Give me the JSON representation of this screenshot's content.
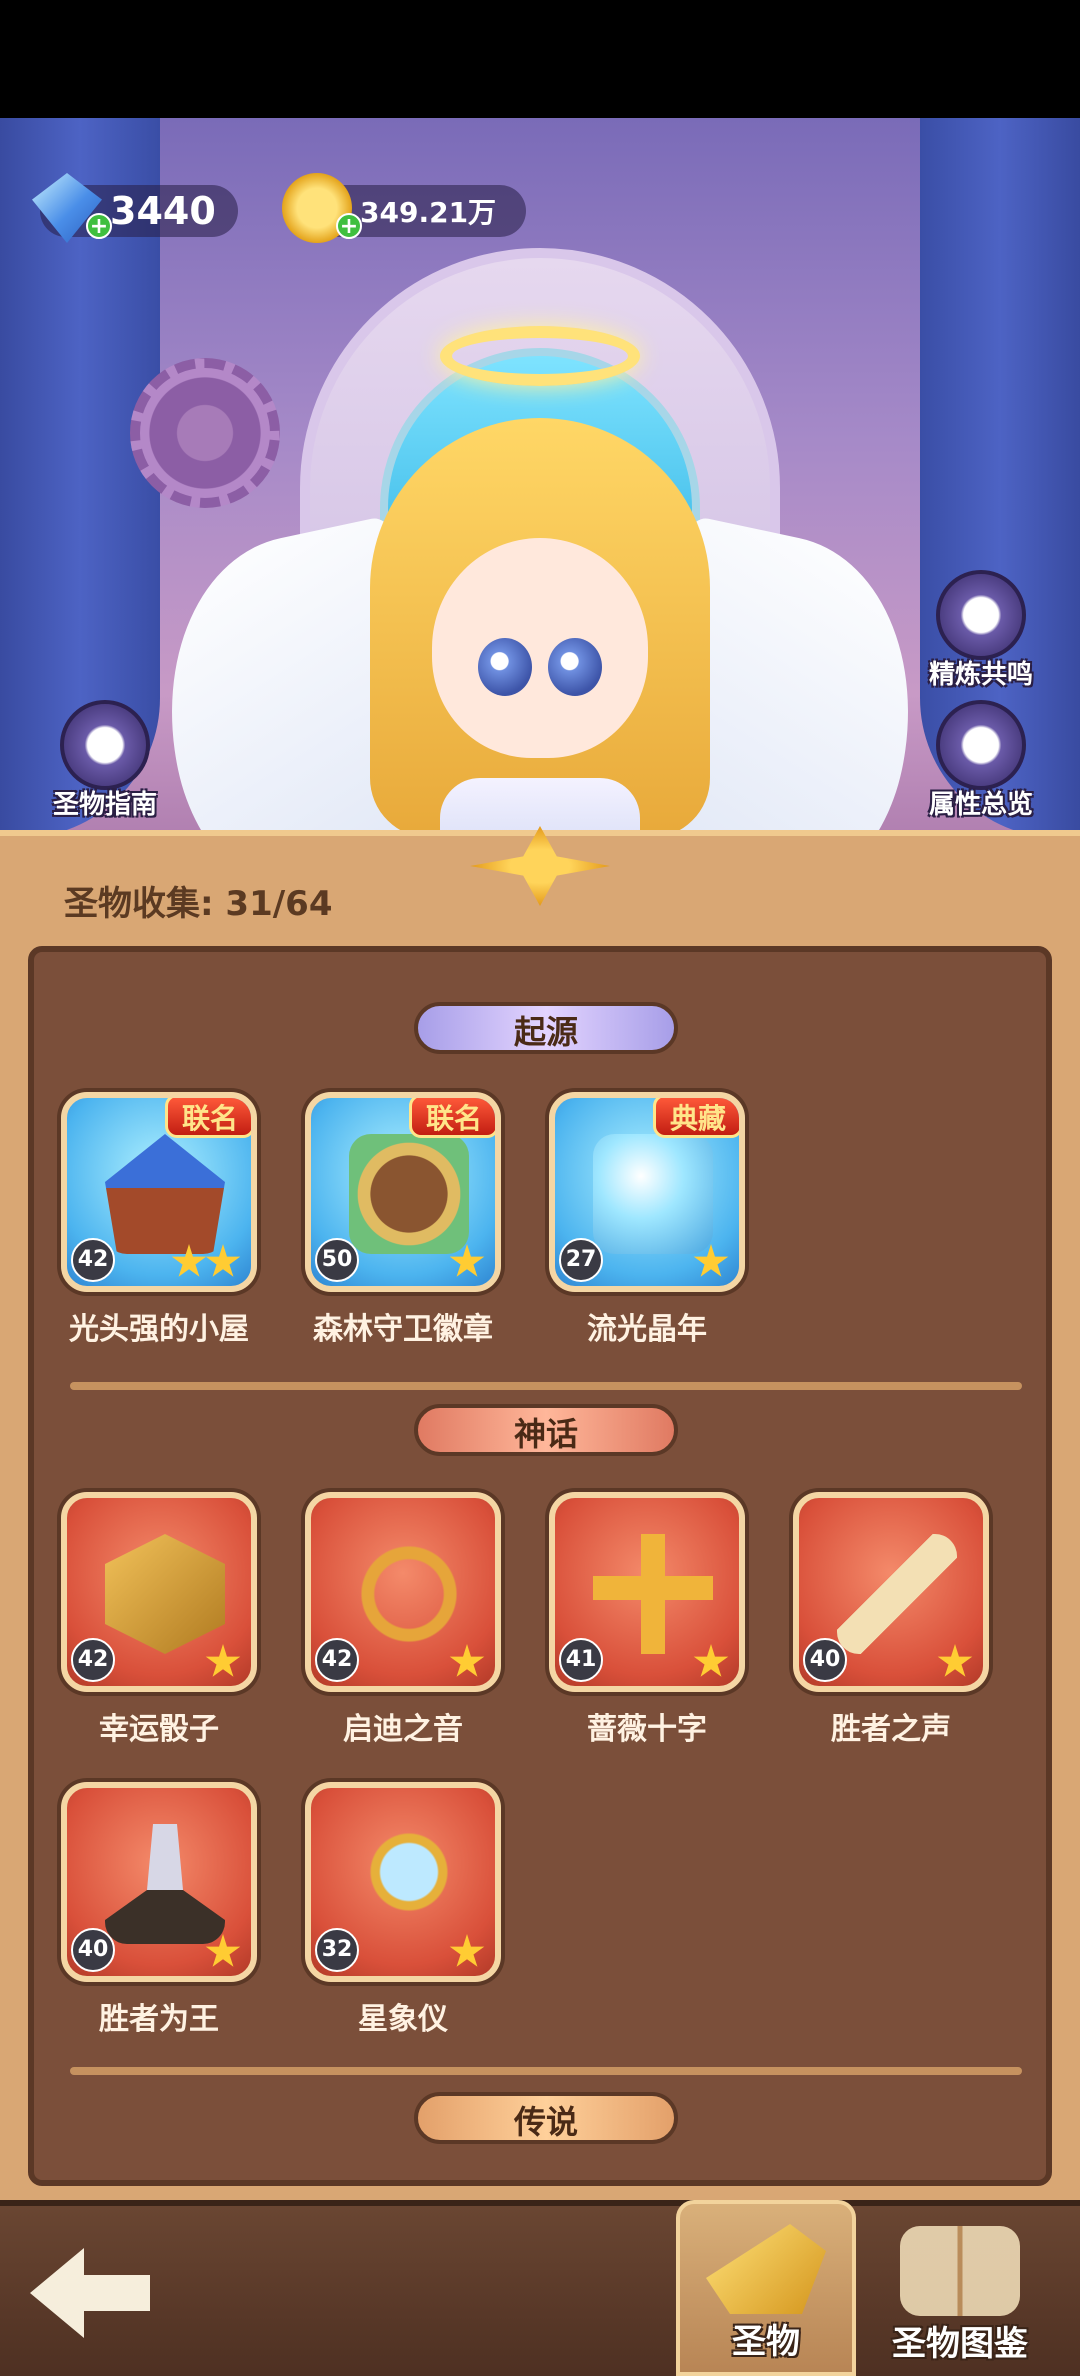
{
  "currencies": {
    "diamonds": {
      "value": "3440",
      "icon": "diamond-icon"
    },
    "gold": {
      "value": "349.21万",
      "icon": "gold-coin-icon"
    }
  },
  "side_buttons": {
    "guide": "圣物指南",
    "resonance": "精炼共鸣",
    "attributes": "属性总览"
  },
  "collection": {
    "title": "圣物收集: 31/64"
  },
  "sections": {
    "origin": {
      "title": "起源",
      "items": [
        {
          "name": "光头强的小屋",
          "level": "42",
          "badge": "联名",
          "stars": 2
        },
        {
          "name": "森林守卫徽章",
          "level": "50",
          "badge": "联名",
          "stars": 1
        },
        {
          "name": "流光晶年",
          "level": "27",
          "badge": "典藏",
          "stars": 1
        }
      ]
    },
    "myth": {
      "title": "神话",
      "items": [
        {
          "name": "幸运骰子",
          "level": "42",
          "stars": 1
        },
        {
          "name": "启迪之音",
          "level": "42",
          "stars": 1
        },
        {
          "name": "蔷薇十字",
          "level": "41",
          "stars": 1
        },
        {
          "name": "胜者之声",
          "level": "40",
          "stars": 1
        },
        {
          "name": "胜者为王",
          "level": "40",
          "stars": 1
        },
        {
          "name": "星象仪",
          "level": "32",
          "stars": 1
        }
      ]
    },
    "legend": {
      "title": "传说"
    }
  },
  "bottom_nav": {
    "tabs": [
      {
        "label": "圣物",
        "icon": "relic-icon",
        "active": true
      },
      {
        "label": "圣物图鉴",
        "icon": "book-icon",
        "active": false
      }
    ]
  },
  "colors": {
    "panel": "#d9a774",
    "inner_panel": "#7b4f3a",
    "origin_card": "#4cb4ef",
    "myth_card": "#d9503a",
    "badge": "#c21e12"
  }
}
